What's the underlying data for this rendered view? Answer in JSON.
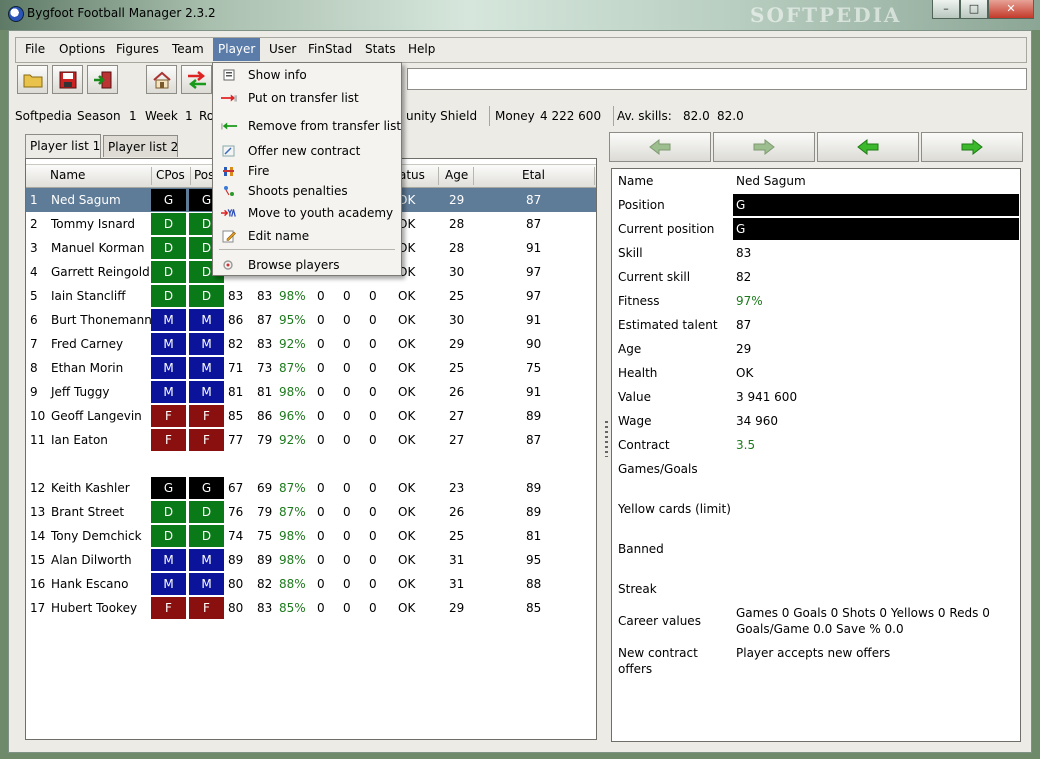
{
  "app": {
    "title": "Bygfoot Football Manager 2.3.2",
    "watermark": "SOFTPEDIA",
    "window_buttons": {
      "minimize": "–",
      "maximize": "□",
      "close": "✕"
    }
  },
  "menubar": {
    "items": [
      {
        "label": "File",
        "name": "menu-file"
      },
      {
        "label": "Options",
        "name": "menu-options"
      },
      {
        "label": "Figures",
        "name": "menu-figures"
      },
      {
        "label": "Team",
        "name": "menu-team"
      },
      {
        "label": "Player",
        "name": "menu-player",
        "active": true
      },
      {
        "label": "User",
        "name": "menu-user"
      },
      {
        "label": "FinStad",
        "name": "menu-finstad"
      },
      {
        "label": "Stats",
        "name": "menu-stats"
      },
      {
        "label": "Help",
        "name": "menu-help"
      }
    ]
  },
  "toolbar": {
    "buttons": [
      {
        "name": "open-button",
        "icon": "folder-icon"
      },
      {
        "name": "save-button",
        "icon": "floppy-disk-icon"
      },
      {
        "name": "quit-button",
        "icon": "exit-door-icon"
      },
      {
        "name": "home-button",
        "icon": "house-icon"
      },
      {
        "name": "transfer-button",
        "icon": "swap-arrows-icon"
      }
    ],
    "entry_value": ""
  },
  "status": {
    "user": "Softpedia",
    "season_label": "Season",
    "season": "1",
    "week_label": "Week",
    "week": "1",
    "round_fragment": "Ro",
    "competition_fragment": "unity Shield",
    "money_label": "Money",
    "money": "4 222 600",
    "avskills_label": "Av. skills:",
    "avskills_1": "82.0",
    "avskills_2": "82.0"
  },
  "tabs": [
    {
      "label": "Player list 1",
      "active": true
    },
    {
      "label": "Player list 2",
      "active": false
    }
  ],
  "table": {
    "headers": {
      "name": "Name",
      "cpos": "CPos",
      "pos": "Pos",
      "status": "atus",
      "age": "Age",
      "etal": "Etal"
    },
    "colors": {
      "G": "#000000",
      "D": "#0a7a18",
      "M": "#0a139a",
      "F": "#8a1010"
    },
    "rows": [
      {
        "num": "1",
        "name": "Ned Sagum",
        "cpos": "G",
        "pos": "G",
        "skill": "",
        "cskill": "",
        "fitness": "",
        "g1": "",
        "g2": "",
        "g3": "",
        "status": "OK",
        "age": "29",
        "etal": "87",
        "selected": true
      },
      {
        "num": "2",
        "name": "Tommy Isnard",
        "cpos": "D",
        "pos": "D",
        "skill": "",
        "cskill": "",
        "fitness": "",
        "g1": "",
        "g2": "",
        "g3": "",
        "status": "OK",
        "age": "28",
        "etal": "87"
      },
      {
        "num": "3",
        "name": "Manuel Korman",
        "cpos": "D",
        "pos": "D",
        "skill": "",
        "cskill": "",
        "fitness": "",
        "g1": "",
        "g2": "",
        "g3": "",
        "status": "OK",
        "age": "28",
        "etal": "91"
      },
      {
        "num": "4",
        "name": "Garrett Reingold",
        "cpos": "D",
        "pos": "D",
        "skill": "",
        "cskill": "",
        "fitness": "",
        "g1": "",
        "g2": "",
        "g3": "",
        "status": "OK",
        "age": "30",
        "etal": "97"
      },
      {
        "num": "5",
        "name": "Iain Stancliff",
        "cpos": "D",
        "pos": "D",
        "skill": "83",
        "cskill": "83",
        "fitness": "98%",
        "g1": "0",
        "g2": "0",
        "g3": "0",
        "status": "OK",
        "age": "25",
        "etal": "97"
      },
      {
        "num": "6",
        "name": "Burt Thonemann",
        "cpos": "M",
        "pos": "M",
        "skill": "86",
        "cskill": "87",
        "fitness": "95%",
        "g1": "0",
        "g2": "0",
        "g3": "0",
        "status": "OK",
        "age": "30",
        "etal": "91"
      },
      {
        "num": "7",
        "name": "Fred Carney",
        "cpos": "M",
        "pos": "M",
        "skill": "82",
        "cskill": "83",
        "fitness": "92%",
        "g1": "0",
        "g2": "0",
        "g3": "0",
        "status": "OK",
        "age": "29",
        "etal": "90"
      },
      {
        "num": "8",
        "name": "Ethan Morin",
        "cpos": "M",
        "pos": "M",
        "skill": "71",
        "cskill": "73",
        "fitness": "87%",
        "g1": "0",
        "g2": "0",
        "g3": "0",
        "status": "OK",
        "age": "25",
        "etal": "75"
      },
      {
        "num": "9",
        "name": "Jeff Tuggy",
        "cpos": "M",
        "pos": "M",
        "skill": "81",
        "cskill": "81",
        "fitness": "98%",
        "g1": "0",
        "g2": "0",
        "g3": "0",
        "status": "OK",
        "age": "26",
        "etal": "91"
      },
      {
        "num": "10",
        "name": "Geoff Langevin",
        "cpos": "F",
        "pos": "F",
        "skill": "85",
        "cskill": "86",
        "fitness": "96%",
        "g1": "0",
        "g2": "0",
        "g3": "0",
        "status": "OK",
        "age": "27",
        "etal": "89"
      },
      {
        "num": "11",
        "name": "Ian Eaton",
        "cpos": "F",
        "pos": "F",
        "skill": "77",
        "cskill": "79",
        "fitness": "92%",
        "g1": "0",
        "g2": "0",
        "g3": "0",
        "status": "OK",
        "age": "27",
        "etal": "87"
      },
      {
        "num": "12",
        "name": "Keith Kashler",
        "cpos": "G",
        "pos": "G",
        "skill": "67",
        "cskill": "69",
        "fitness": "87%",
        "g1": "0",
        "g2": "0",
        "g3": "0",
        "status": "OK",
        "age": "23",
        "etal": "89",
        "gap_before": true
      },
      {
        "num": "13",
        "name": "Brant Street",
        "cpos": "D",
        "pos": "D",
        "skill": "76",
        "cskill": "79",
        "fitness": "87%",
        "g1": "0",
        "g2": "0",
        "g3": "0",
        "status": "OK",
        "age": "26",
        "etal": "89"
      },
      {
        "num": "14",
        "name": "Tony Demchick",
        "cpos": "D",
        "pos": "D",
        "skill": "74",
        "cskill": "75",
        "fitness": "98%",
        "g1": "0",
        "g2": "0",
        "g3": "0",
        "status": "OK",
        "age": "25",
        "etal": "81"
      },
      {
        "num": "15",
        "name": "Alan Dilworth",
        "cpos": "M",
        "pos": "M",
        "skill": "89",
        "cskill": "89",
        "fitness": "98%",
        "g1": "0",
        "g2": "0",
        "g3": "0",
        "status": "OK",
        "age": "31",
        "etal": "95"
      },
      {
        "num": "16",
        "name": "Hank Escano",
        "cpos": "M",
        "pos": "M",
        "skill": "80",
        "cskill": "82",
        "fitness": "88%",
        "g1": "0",
        "g2": "0",
        "g3": "0",
        "status": "OK",
        "age": "31",
        "etal": "88"
      },
      {
        "num": "17",
        "name": "Hubert Tookey",
        "cpos": "F",
        "pos": "F",
        "skill": "80",
        "cskill": "83",
        "fitness": "85%",
        "g1": "0",
        "g2": "0",
        "g3": "0",
        "status": "OK",
        "age": "29",
        "etal": "85"
      }
    ]
  },
  "nav_buttons": [
    {
      "name": "prev-prev-button",
      "icon": "arrow-left-icon",
      "color": "#9dbf8f"
    },
    {
      "name": "next-next-button",
      "icon": "arrow-right-icon",
      "color": "#9dbf8f"
    },
    {
      "name": "prev-button",
      "icon": "arrow-left-icon",
      "color": "#3cb82c"
    },
    {
      "name": "next-button",
      "icon": "arrow-right-icon",
      "color": "#3cb82c"
    }
  ],
  "player_info": [
    {
      "label": "Name",
      "value": "Ned Sagum"
    },
    {
      "label": "Position",
      "value": "G",
      "style": "black"
    },
    {
      "label": "Current position",
      "value": "G",
      "style": "black"
    },
    {
      "label": "Skill",
      "value": "83"
    },
    {
      "label": "Current skill",
      "value": "82"
    },
    {
      "label": "Fitness",
      "value": "97%",
      "style": "green"
    },
    {
      "label": "Estimated talent",
      "value": "87"
    },
    {
      "label": "Age",
      "value": "29"
    },
    {
      "label": "Health",
      "value": "OK"
    },
    {
      "label": "Value",
      "value": "3 941 600"
    },
    {
      "label": "Wage",
      "value": "34 960"
    },
    {
      "label": "Contract",
      "value": "3.5",
      "style": "green"
    },
    {
      "label": "Games/Goals",
      "value": ""
    },
    {
      "label": "Yellow cards (limit)",
      "value": ""
    },
    {
      "label": "Banned",
      "value": ""
    },
    {
      "label": "Streak",
      "value": ""
    },
    {
      "label": "Career values",
      "value": "Games 0 Goals 0 Shots 0 Yellows 0 Reds 0",
      "value2": "Goals/Game 0.0 Save % 0.0"
    },
    {
      "label": "New contract",
      "label2": "offers",
      "value": "Player accepts new offers"
    }
  ],
  "player_menu": {
    "items": [
      {
        "label": "Show info",
        "icon": "info-icon"
      },
      {
        "label": "Put on transfer list",
        "icon": "red-arrow-right-icon"
      },
      {
        "label": "Remove from transfer list",
        "icon": "green-arrow-left-icon"
      },
      {
        "label": "Offer new contract",
        "icon": "contract-icon"
      },
      {
        "label": "Fire",
        "icon": "fire-icon"
      },
      {
        "label": "Shoots penalties",
        "icon": "penalty-icon"
      },
      {
        "label": "Move to youth academy",
        "icon": "youth-academy-icon"
      },
      {
        "label": "Edit name",
        "icon": "edit-icon"
      },
      {
        "label": "Browse players",
        "icon": "browse-icon"
      }
    ]
  }
}
